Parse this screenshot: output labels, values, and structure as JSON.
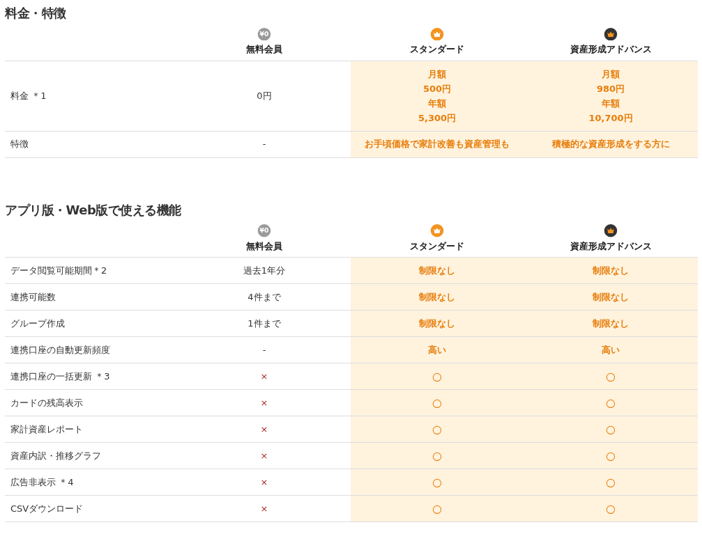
{
  "sections": [
    {
      "title": "料金・特徴",
      "plans": [
        {
          "name": "無料会員",
          "kind": "free",
          "badge": "¥0"
        },
        {
          "name": "スタンダード",
          "kind": "standard"
        },
        {
          "name": "資産形成アドバンス",
          "kind": "advance"
        }
      ],
      "rows": [
        {
          "label": "料金 ＊1",
          "kind": "value",
          "cells": [
            [
              "0円"
            ],
            [
              "月額",
              "500円",
              "年額",
              "5,300円"
            ],
            [
              "月額",
              "980円",
              "年額",
              "10,700円"
            ]
          ]
        },
        {
          "label": "特徴",
          "kind": "value",
          "cells": [
            "-",
            "お手頃価格で家計改善も資産管理も",
            "積極的な資産形成をする方に"
          ]
        }
      ]
    },
    {
      "title": "アプリ版・Web版で使える機能",
      "plans": [
        {
          "name": "無料会員",
          "kind": "free",
          "badge": "¥0"
        },
        {
          "name": "スタンダード",
          "kind": "standard"
        },
        {
          "name": "資産形成アドバンス",
          "kind": "advance"
        }
      ],
      "rows": [
        {
          "label": "データ閲覧可能期間＊2",
          "kind": "value",
          "cells": [
            "過去1年分",
            "制限なし",
            "制限なし"
          ]
        },
        {
          "label": "連携可能数",
          "kind": "value",
          "cells": [
            "4件まで",
            "制限なし",
            "制限なし"
          ]
        },
        {
          "label": "グループ作成",
          "kind": "value",
          "cells": [
            "1件まで",
            "制限なし",
            "制限なし"
          ]
        },
        {
          "label": "連携口座の自動更新頻度",
          "kind": "value",
          "cells": [
            "-",
            "高い",
            "高い"
          ]
        },
        {
          "label": "連携口座の一括更新 ＊3",
          "kind": "availability",
          "cells": [
            "×",
            "○",
            "○"
          ]
        },
        {
          "label": "カードの残高表示",
          "kind": "availability",
          "cells": [
            "×",
            "○",
            "○"
          ]
        },
        {
          "label": "家計資産レポート",
          "kind": "availability",
          "cells": [
            "×",
            "○",
            "○"
          ]
        },
        {
          "label": "資産内訳・推移グラフ",
          "kind": "availability",
          "cells": [
            "×",
            "○",
            "○"
          ]
        },
        {
          "label": "広告非表示 ＊4",
          "kind": "availability",
          "cells": [
            "×",
            "○",
            "○"
          ]
        },
        {
          "label": "CSVダウンロード",
          "kind": "availability",
          "cells": [
            "×",
            "○",
            "○"
          ]
        }
      ]
    }
  ]
}
